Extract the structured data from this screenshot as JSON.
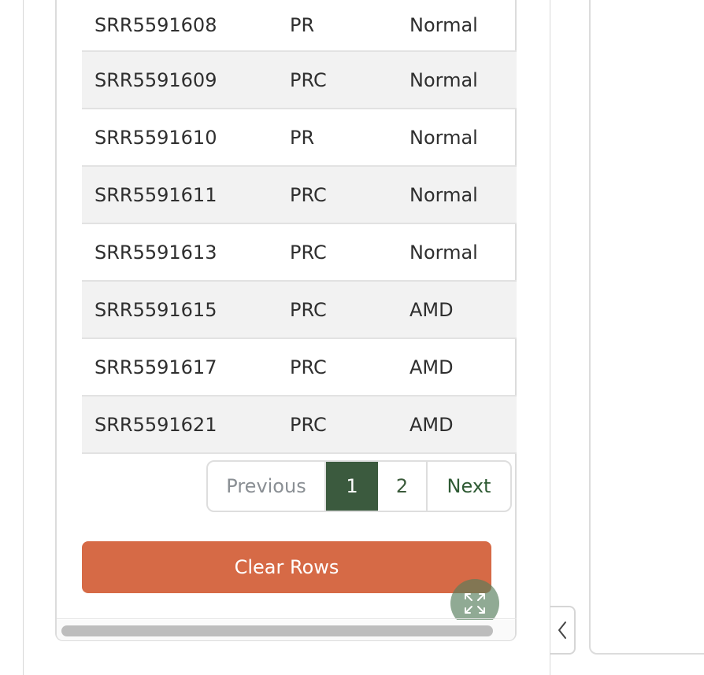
{
  "table": {
    "rows": [
      {
        "id": "SRR5591608",
        "type": "PR",
        "status": "Normal"
      },
      {
        "id": "SRR5591609",
        "type": "PRC",
        "status": "Normal"
      },
      {
        "id": "SRR5591610",
        "type": "PR",
        "status": "Normal"
      },
      {
        "id": "SRR5591611",
        "type": "PRC",
        "status": "Normal"
      },
      {
        "id": "SRR5591613",
        "type": "PRC",
        "status": "Normal"
      },
      {
        "id": "SRR5591615",
        "type": "PRC",
        "status": "AMD"
      },
      {
        "id": "SRR5591617",
        "type": "PRC",
        "status": "AMD"
      },
      {
        "id": "SRR5591621",
        "type": "PRC",
        "status": "AMD"
      }
    ]
  },
  "pagination": {
    "previous": "Previous",
    "page1": "1",
    "page2": "2",
    "next": "Next",
    "current_page": 1
  },
  "actions": {
    "clear_rows": "Clear Rows"
  },
  "icons": {
    "expand": "expand-icon",
    "collapse": "chevron-left-icon"
  },
  "colors": {
    "accent_green": "#3b5a3e",
    "clear_button": "#d66a46",
    "row_shade": "#f2f2f2"
  }
}
